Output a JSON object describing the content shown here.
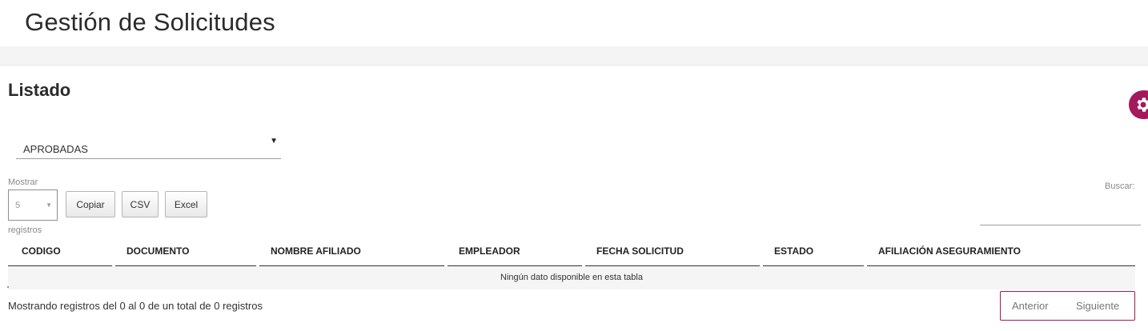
{
  "header": {
    "title": "Gestión de Solicitudes"
  },
  "section": {
    "title": "Listado"
  },
  "settings": {
    "icon": "gear-icon",
    "color": "#a3195b"
  },
  "filter": {
    "selected": "APROBADAS",
    "caret": "▼"
  },
  "length": {
    "label_top": "Mostrar",
    "selected": "5",
    "caret": "▼",
    "label_bottom": "registros"
  },
  "buttons": {
    "copy": "Copiar",
    "csv": "CSV",
    "excel": "Excel"
  },
  "search": {
    "label": "Buscar:",
    "value": ""
  },
  "table": {
    "columns": [
      "CODIGO",
      "DOCUMENTO",
      "NOMBRE AFILIADO",
      "EMPLEADOR",
      "FECHA SOLICITUD",
      "ESTADO",
      "AFILIACIÓN ASEGURAMIENTO"
    ],
    "empty_message": "Ningún dato disponible en esta tabla"
  },
  "footer": {
    "info": "Mostrando registros del 0 al 0 de un total de 0 registros",
    "prev": "Anterior",
    "next": "Siguiente",
    "accent": "#a3195b"
  }
}
